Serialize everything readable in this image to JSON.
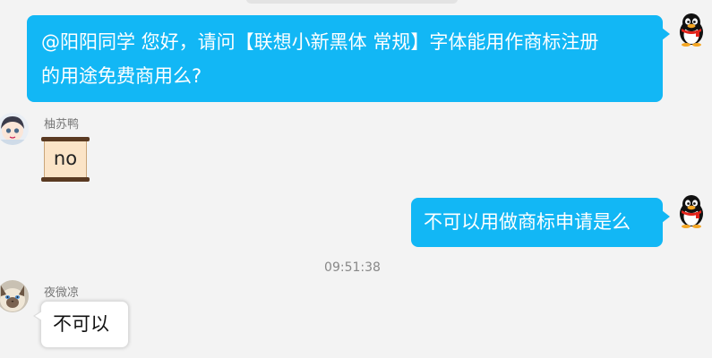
{
  "messages": [
    {
      "direction": "outgoing",
      "text": "@阳阳同学 您好，请问【联想小新黑体 常规】字体能用作商标注册\n的用途免费商用么?",
      "avatar_icon": "qq-penguin-icon"
    },
    {
      "direction": "incoming",
      "sender": "柚苏鸭",
      "text": "no",
      "style": "scroll-sticker",
      "avatar_icon": "cartoon-girl-avatar"
    },
    {
      "direction": "outgoing",
      "text": "不可以用做商标申请是么",
      "avatar_icon": "qq-penguin-icon"
    },
    {
      "type": "timestamp",
      "text": "09:51:38"
    },
    {
      "direction": "incoming",
      "sender": "夜微凉",
      "text": "不可以",
      "avatar_icon": "siamese-cat-avatar"
    }
  ],
  "colors": {
    "outgoing_bubble": "#12b7f5",
    "background": "#f3f3f3",
    "incoming_bubble": "#ffffff",
    "sticker_paper": "#fbe4c7",
    "sticker_roll": "#5a3a22"
  }
}
